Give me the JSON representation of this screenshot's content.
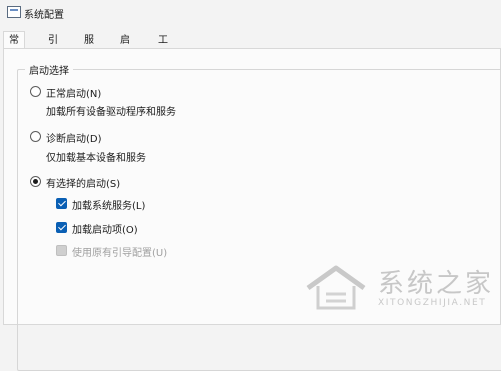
{
  "window": {
    "title": "系统配置",
    "icon": "msconfig-icon"
  },
  "tabs": [
    {
      "label": "常规",
      "active": true
    },
    {
      "label": "引导",
      "active": false
    },
    {
      "label": "服务",
      "active": false
    },
    {
      "label": "启动",
      "active": false
    },
    {
      "label": "工具",
      "active": false
    }
  ],
  "startup_selection": {
    "legend": "启动选择",
    "options": [
      {
        "label": "正常启动(N)",
        "description": "加载所有设备驱动程序和服务",
        "selected": false
      },
      {
        "label": "诊断启动(D)",
        "description": "仅加载基本设备和服务",
        "selected": false
      },
      {
        "label": "有选择的启动(S)",
        "selected": true
      }
    ],
    "selective_items": [
      {
        "label": "加载系统服务(L)",
        "checked": true,
        "enabled": true
      },
      {
        "label": "加载启动项(O)",
        "checked": true,
        "enabled": true
      },
      {
        "label": "使用原有引导配置(U)",
        "checked": true,
        "enabled": false
      }
    ]
  },
  "watermark": {
    "text": "系统之家",
    "url": "XITONGZHIJIA.NET"
  }
}
